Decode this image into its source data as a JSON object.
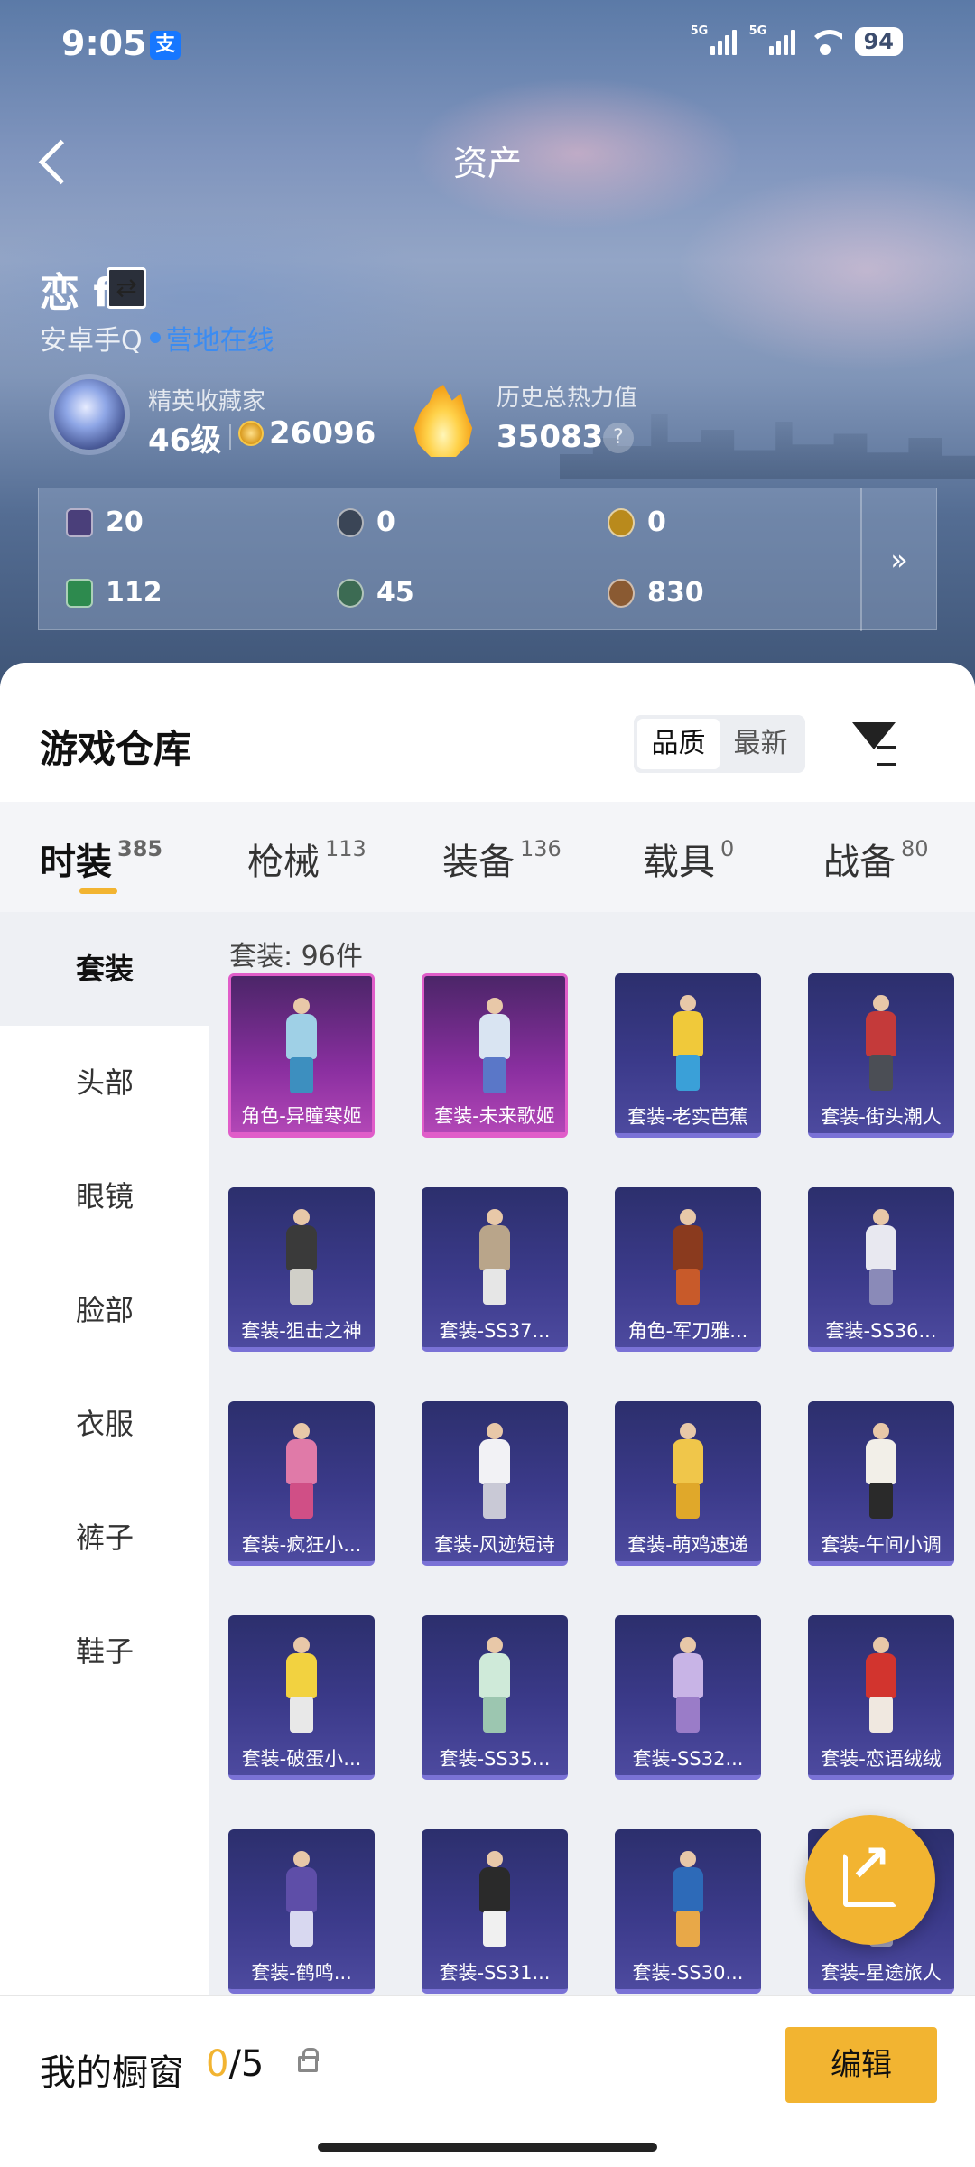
{
  "status": {
    "time": "9:05",
    "pay_badge": "支",
    "signal1": "5G",
    "signal2": "5G",
    "battery": "94"
  },
  "header": {
    "title": "资产"
  },
  "profile": {
    "name": "恋 f",
    "platform": "安卓手Q",
    "online_text": "营地在线",
    "collector_label": "精英收藏家",
    "level": "46级",
    "coins": "26096",
    "heat_label": "历史总热力值",
    "heat_value": "35083",
    "help": "?"
  },
  "stats": [
    {
      "value": "20",
      "icon": "card-ticket-icon",
      "color": "#4a3f7a"
    },
    {
      "value": "0",
      "icon": "silver-coin-icon",
      "color": "#3a4556"
    },
    {
      "value": "0",
      "icon": "gold-coin-icon",
      "color": "#b98a1c"
    },
    {
      "value": "112",
      "icon": "green-ticket-icon",
      "color": "#2d8a4e"
    },
    {
      "value": "45",
      "icon": "green-orb-icon",
      "color": "#3c6b53"
    },
    {
      "value": "830",
      "icon": "bronze-coin-icon",
      "color": "#8a5a32"
    }
  ],
  "stats_more": "»",
  "warehouse": {
    "title": "游戏仓库",
    "sort_options": [
      "品质",
      "最新"
    ],
    "sort_selected": "品质"
  },
  "tabs": [
    {
      "label": "时装",
      "count": "385"
    },
    {
      "label": "枪械",
      "count": "113"
    },
    {
      "label": "装备",
      "count": "136"
    },
    {
      "label": "载具",
      "count": "0"
    },
    {
      "label": "战备",
      "count": "80"
    }
  ],
  "side_items": [
    "套装",
    "头部",
    "眼镜",
    "脸部",
    "衣服",
    "裤子",
    "鞋子"
  ],
  "content_title": "套装: 96件",
  "items": [
    {
      "label": "角色-异瞳寒姬",
      "rarity": "legendary",
      "color": "#9fd0e6",
      "accent": "#3d8fbf"
    },
    {
      "label": "套装-未来歌姬",
      "rarity": "legendary",
      "color": "#d9e4f2",
      "accent": "#5a77c8"
    },
    {
      "label": "套装-老实芭蕉",
      "rarity": "epic",
      "color": "#f0c93a",
      "accent": "#3aa0d8"
    },
    {
      "label": "套装-街头潮人",
      "rarity": "epic",
      "color": "#c43a3a",
      "accent": "#4b4e55"
    },
    {
      "label": "套装-狙击之神",
      "rarity": "epic",
      "color": "#3a3a3a",
      "accent": "#d0cfc8"
    },
    {
      "label": "套装-SS37...",
      "rarity": "epic",
      "color": "#b9a58a",
      "accent": "#e6e6e6"
    },
    {
      "label": "角色-军刀雅...",
      "rarity": "epic",
      "color": "#8a3a1e",
      "accent": "#c85a2a"
    },
    {
      "label": "套装-SS36...",
      "rarity": "epic",
      "color": "#e8e8f0",
      "accent": "#8a8ab8"
    },
    {
      "label": "套装-疯狂小...",
      "rarity": "epic",
      "color": "#e07aa8",
      "accent": "#d04f86"
    },
    {
      "label": "套装-风迹短诗",
      "rarity": "epic",
      "color": "#f2f2f5",
      "accent": "#c9c9d6"
    },
    {
      "label": "套装-萌鸡速递",
      "rarity": "epic",
      "color": "#f0c64a",
      "accent": "#e0a82a"
    },
    {
      "label": "套装-午间小调",
      "rarity": "epic",
      "color": "#f2efe8",
      "accent": "#2a2a2a"
    },
    {
      "label": "套装-破蛋小...",
      "rarity": "epic",
      "color": "#f2d240",
      "accent": "#e8e8e8"
    },
    {
      "label": "套装-SS35...",
      "rarity": "epic",
      "color": "#cfead9",
      "accent": "#9cc6b0"
    },
    {
      "label": "套装-SS32...",
      "rarity": "epic",
      "color": "#c8b4e6",
      "accent": "#9a7cc8"
    },
    {
      "label": "套装-恋语绒绒",
      "rarity": "epic",
      "color": "#d2342e",
      "accent": "#f0e8e0"
    },
    {
      "label": "套装-鹤鸣...",
      "rarity": "epic",
      "color": "#5e4ea8",
      "accent": "#d8d8f0"
    },
    {
      "label": "套装-SS31...",
      "rarity": "epic",
      "color": "#2a2a2a",
      "accent": "#f0f0f0"
    },
    {
      "label": "套装-SS30...",
      "rarity": "epic",
      "color": "#2d6ab8",
      "accent": "#e8a848"
    },
    {
      "label": "套装-星途旅人",
      "rarity": "epic",
      "color": "#e8e8f2",
      "accent": "#a8a8c8"
    }
  ],
  "showcase": {
    "label": "我的橱窗",
    "current": "0",
    "total": "/5",
    "edit": "编辑"
  },
  "colors": {
    "accent": "#f2b431",
    "link": "#3b8cf2"
  }
}
